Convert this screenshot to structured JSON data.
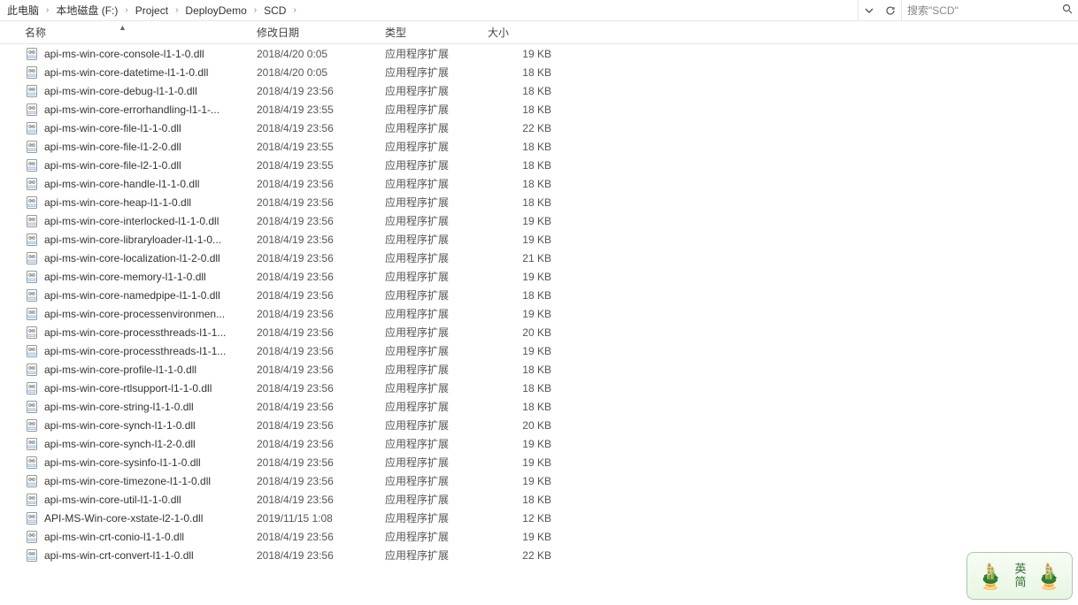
{
  "breadcrumb": [
    {
      "label": "此电脑"
    },
    {
      "label": "本地磁盘 (F:)"
    },
    {
      "label": "Project"
    },
    {
      "label": "DeployDemo"
    },
    {
      "label": "SCD"
    }
  ],
  "search_placeholder": "搜索\"SCD\"",
  "columns": {
    "name": "名称",
    "date": "修改日期",
    "type": "类型",
    "size": "大小"
  },
  "type_label": "应用程序扩展",
  "files": [
    {
      "name": "api-ms-win-core-console-l1-1-0.dll",
      "date": "2018/4/20 0:05",
      "size": "19 KB"
    },
    {
      "name": "api-ms-win-core-datetime-l1-1-0.dll",
      "date": "2018/4/20 0:05",
      "size": "18 KB"
    },
    {
      "name": "api-ms-win-core-debug-l1-1-0.dll",
      "date": "2018/4/19 23:56",
      "size": "18 KB"
    },
    {
      "name": "api-ms-win-core-errorhandling-l1-1-...",
      "date": "2018/4/19 23:55",
      "size": "18 KB"
    },
    {
      "name": "api-ms-win-core-file-l1-1-0.dll",
      "date": "2018/4/19 23:56",
      "size": "22 KB"
    },
    {
      "name": "api-ms-win-core-file-l1-2-0.dll",
      "date": "2018/4/19 23:55",
      "size": "18 KB"
    },
    {
      "name": "api-ms-win-core-file-l2-1-0.dll",
      "date": "2018/4/19 23:55",
      "size": "18 KB"
    },
    {
      "name": "api-ms-win-core-handle-l1-1-0.dll",
      "date": "2018/4/19 23:56",
      "size": "18 KB"
    },
    {
      "name": "api-ms-win-core-heap-l1-1-0.dll",
      "date": "2018/4/19 23:56",
      "size": "18 KB"
    },
    {
      "name": "api-ms-win-core-interlocked-l1-1-0.dll",
      "date": "2018/4/19 23:56",
      "size": "19 KB"
    },
    {
      "name": "api-ms-win-core-libraryloader-l1-1-0...",
      "date": "2018/4/19 23:56",
      "size": "19 KB"
    },
    {
      "name": "api-ms-win-core-localization-l1-2-0.dll",
      "date": "2018/4/19 23:56",
      "size": "21 KB"
    },
    {
      "name": "api-ms-win-core-memory-l1-1-0.dll",
      "date": "2018/4/19 23:56",
      "size": "19 KB"
    },
    {
      "name": "api-ms-win-core-namedpipe-l1-1-0.dll",
      "date": "2018/4/19 23:56",
      "size": "18 KB"
    },
    {
      "name": "api-ms-win-core-processenvironmen...",
      "date": "2018/4/19 23:56",
      "size": "19 KB"
    },
    {
      "name": "api-ms-win-core-processthreads-l1-1...",
      "date": "2018/4/19 23:56",
      "size": "20 KB"
    },
    {
      "name": "api-ms-win-core-processthreads-l1-1...",
      "date": "2018/4/19 23:56",
      "size": "19 KB"
    },
    {
      "name": "api-ms-win-core-profile-l1-1-0.dll",
      "date": "2018/4/19 23:56",
      "size": "18 KB"
    },
    {
      "name": "api-ms-win-core-rtlsupport-l1-1-0.dll",
      "date": "2018/4/19 23:56",
      "size": "18 KB"
    },
    {
      "name": "api-ms-win-core-string-l1-1-0.dll",
      "date": "2018/4/19 23:56",
      "size": "18 KB"
    },
    {
      "name": "api-ms-win-core-synch-l1-1-0.dll",
      "date": "2018/4/19 23:56",
      "size": "20 KB"
    },
    {
      "name": "api-ms-win-core-synch-l1-2-0.dll",
      "date": "2018/4/19 23:56",
      "size": "19 KB"
    },
    {
      "name": "api-ms-win-core-sysinfo-l1-1-0.dll",
      "date": "2018/4/19 23:56",
      "size": "19 KB"
    },
    {
      "name": "api-ms-win-core-timezone-l1-1-0.dll",
      "date": "2018/4/19 23:56",
      "size": "19 KB"
    },
    {
      "name": "api-ms-win-core-util-l1-1-0.dll",
      "date": "2018/4/19 23:56",
      "size": "18 KB"
    },
    {
      "name": "API-MS-Win-core-xstate-l2-1-0.dll",
      "date": "2019/11/15 1:08",
      "size": "12 KB"
    },
    {
      "name": "api-ms-win-crt-conio-l1-1-0.dll",
      "date": "2018/4/19 23:56",
      "size": "19 KB"
    },
    {
      "name": "api-ms-win-crt-convert-l1-1-0.dll",
      "date": "2018/4/19 23:56",
      "size": "22 KB"
    }
  ],
  "badge_text": "英简"
}
